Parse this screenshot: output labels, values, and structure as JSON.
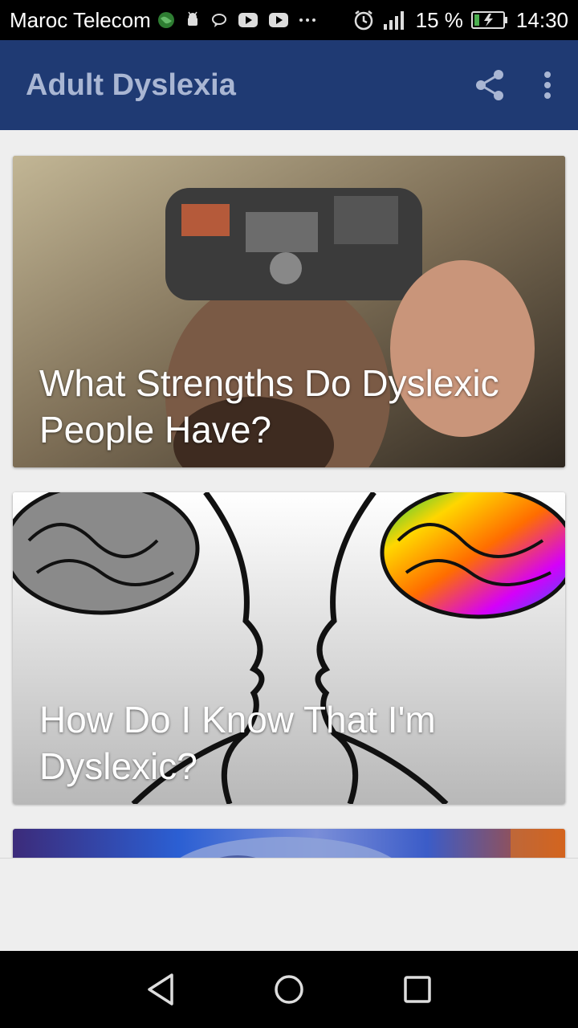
{
  "status_bar": {
    "carrier": "Maroc Telecom",
    "battery": "15 %",
    "time": "14:30",
    "icons": [
      "globe-icon",
      "android-icon",
      "chat-icon",
      "youtube-icon",
      "youtube-icon",
      "more-dots-icon",
      "alarm-icon",
      "signal-icon",
      "battery-icon"
    ]
  },
  "app_bar": {
    "title": "Adult Dyslexia",
    "actions": [
      "share-icon",
      "overflow-menu-icon"
    ]
  },
  "cards": [
    {
      "title": "What Strengths Do Dyslexic People Have?",
      "image": "man-with-mechanical-brain"
    },
    {
      "title": "How Do I Know That I'm Dyslexic?",
      "image": "two-face-profiles-with-brains"
    },
    {
      "title": "",
      "image": "colorful-brain"
    }
  ],
  "nav_bar": {
    "buttons": [
      "back-icon",
      "home-icon",
      "recents-icon"
    ]
  },
  "colors": {
    "app_bar": "#1f3a73",
    "app_title": "#a9b6d3",
    "background": "#eeeeee"
  }
}
